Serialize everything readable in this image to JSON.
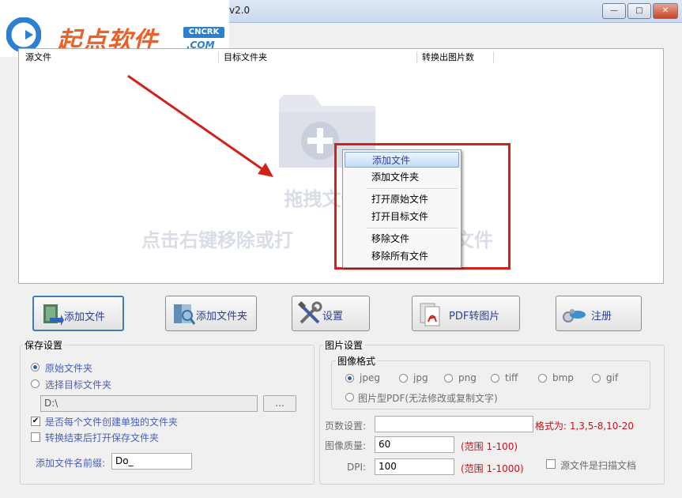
{
  "window": {
    "title": "PDF转图片工具(PDF to JPG Converter)v2.0 v2.0",
    "title_visible": "v2.0",
    "buttons": {
      "minimize": "—",
      "maximize": "□",
      "close": "✕"
    }
  },
  "watermark": {
    "brand": "起点软件",
    "badge": "CNCRK",
    "domain": ".COM"
  },
  "file_list": {
    "columns": [
      "源文件",
      "目标文件夹",
      "转换出图片数"
    ],
    "hint_line1": "拖拽文件或文",
    "hint_line1_tail": "件",
    "hint_line2": "点击右键移除或打",
    "hint_line2_tail": "文件"
  },
  "context_menu": {
    "items": [
      "添加文件",
      "添加文件夹",
      "打开原始文件",
      "打开目标文件",
      "移除文件",
      "移除所有文件"
    ],
    "selected_index": 0
  },
  "toolbar": {
    "add_file": "添加文件",
    "add_folder": "添加文件夹",
    "settings": "设置",
    "pdf_to_image": "PDF转图片",
    "register": "注册"
  },
  "save_settings": {
    "title": "保存设置",
    "opt_original": "原始文件夹",
    "opt_target": "选择目标文件夹",
    "selected": "original",
    "path_value": "D:\\",
    "browse_label": "...",
    "chk_each_folder": "是否每个文件创建单独的文件夹",
    "chk_each_folder_checked": true,
    "chk_open_after": "转换结束后打开保存文件夹",
    "chk_open_after_checked": false,
    "prefix_label": "添加文件名前缀:",
    "prefix_value": "Do_"
  },
  "image_settings": {
    "title": "图片设置",
    "format_title": "图像格式",
    "formats": [
      "jpeg",
      "jpg",
      "png",
      "tiff",
      "bmp",
      "gif"
    ],
    "selected_format": "jpeg",
    "pdf_image_option": "图片型PDF(无法修改或复制文字)",
    "pages_label": "页数设置:",
    "pages_value": "",
    "pages_format_hint": "格式为: 1,3,5-8,10-20",
    "quality_label": "图像质量:",
    "quality_value": "60",
    "quality_range": "(范围 1-100)",
    "dpi_label": "DPI:",
    "dpi_value": "100",
    "dpi_range": "(范围 1-1000)",
    "scan_doc_label": "源文件是扫描文档",
    "scan_doc_checked": false
  },
  "colors": {
    "accent": "#2b3f8f",
    "highlight_box": "#d0221b",
    "arrow": "#d0221b",
    "hint_text": "#d8dde6",
    "range_text": "#c0121b"
  }
}
